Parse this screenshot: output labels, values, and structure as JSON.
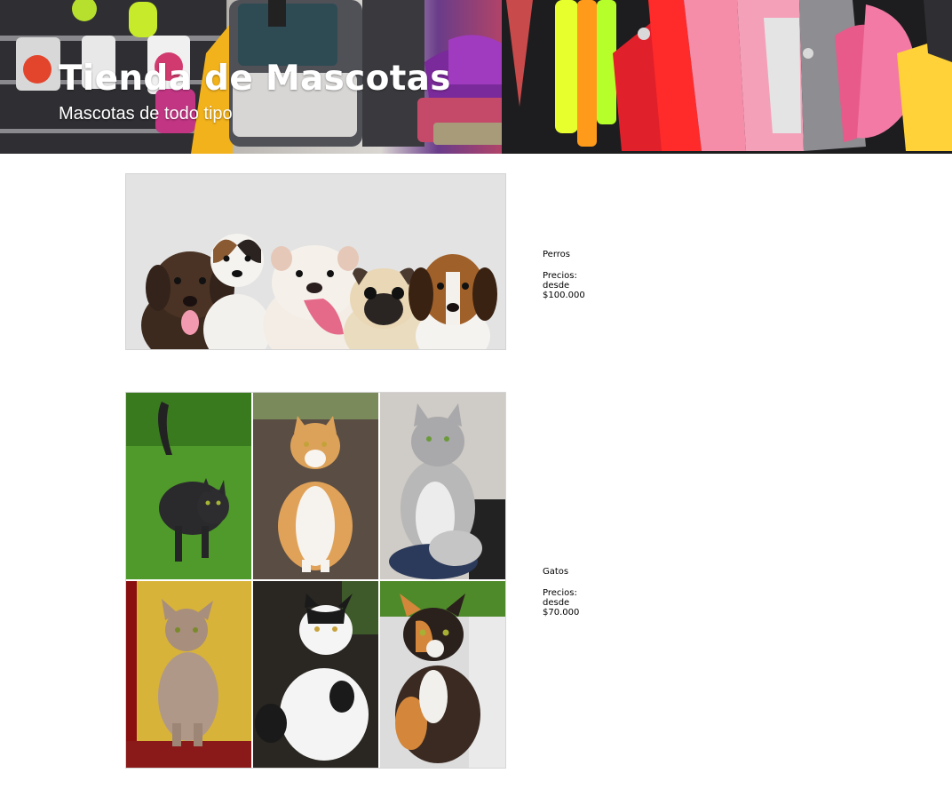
{
  "hero": {
    "title": "Tienda de Mascotas",
    "subtitle": "Mascotas de todo tipo",
    "background_image": "pet-shop-shelves-with-toys-bags-and-colorful-collars"
  },
  "products": [
    {
      "name": "Perros",
      "price": "Precios: desde $100.000",
      "image": "five-puppies-group-photo"
    },
    {
      "name": "Gatos",
      "price": "Precios: desde $70.000",
      "images": [
        "black-cat-on-grass",
        "orange-white-cat-on-leaves",
        "grey-longhair-cat",
        "burmese-cat-on-yellow",
        "black-white-cat",
        "calico-cat"
      ]
    }
  ],
  "colors": {
    "background": "#ffffff",
    "hero_text": "#ffffff",
    "body_text": "#000000",
    "dog_photo_bg": "#e3e3e3"
  }
}
